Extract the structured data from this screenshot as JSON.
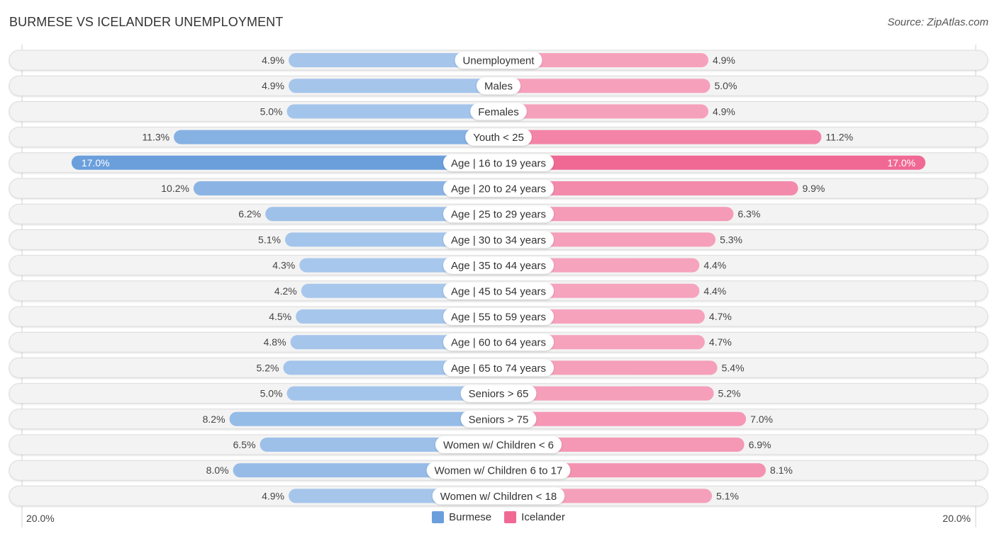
{
  "header": {
    "title": "BURMESE VS ICELANDER UNEMPLOYMENT",
    "source": "Source: ZipAtlas.com"
  },
  "colors": {
    "burmese": "#6a9fdc",
    "burmese_light": "#a9c8ec",
    "icelander": "#f06994",
    "icelander_light": "#f6a5bf"
  },
  "axis": {
    "left_label": "20.0%",
    "right_label": "20.0%"
  },
  "legend": {
    "items": [
      {
        "label": "Burmese",
        "color": "#6a9fdc"
      },
      {
        "label": "Icelander",
        "color": "#f06994"
      }
    ]
  },
  "chart_data": {
    "type": "bar",
    "orientation": "horizontal-diverging",
    "title": "BURMESE VS ICELANDER UNEMPLOYMENT",
    "xlabel": "",
    "ylabel": "",
    "xlim": [
      -20,
      20
    ],
    "legend_position": "bottom-center",
    "categories": [
      "Unemployment",
      "Males",
      "Females",
      "Youth < 25",
      "Age | 16 to 19 years",
      "Age | 20 to 24 years",
      "Age | 25 to 29 years",
      "Age | 30 to 34 years",
      "Age | 35 to 44 years",
      "Age | 45 to 54 years",
      "Age | 55 to 59 years",
      "Age | 60 to 64 years",
      "Age | 65 to 74 years",
      "Seniors > 65",
      "Seniors > 75",
      "Women w/ Children < 6",
      "Women w/ Children 6 to 17",
      "Women w/ Children < 18"
    ],
    "series": [
      {
        "name": "Burmese",
        "side": "left",
        "values": [
          4.9,
          4.9,
          5.0,
          11.3,
          17.0,
          10.2,
          6.2,
          5.1,
          4.3,
          4.2,
          4.5,
          4.8,
          5.2,
          5.0,
          8.2,
          6.5,
          8.0,
          4.9
        ],
        "labels": [
          "4.9%",
          "4.9%",
          "5.0%",
          "11.3%",
          "17.0%",
          "10.2%",
          "6.2%",
          "5.1%",
          "4.3%",
          "4.2%",
          "4.5%",
          "4.8%",
          "5.2%",
          "5.0%",
          "8.2%",
          "6.5%",
          "8.0%",
          "4.9%"
        ]
      },
      {
        "name": "Icelander",
        "side": "right",
        "values": [
          4.9,
          5.0,
          4.9,
          11.2,
          17.0,
          9.9,
          6.3,
          5.3,
          4.4,
          4.4,
          4.7,
          4.7,
          5.4,
          5.2,
          7.0,
          6.9,
          8.1,
          5.1
        ],
        "labels": [
          "4.9%",
          "5.0%",
          "4.9%",
          "11.2%",
          "17.0%",
          "9.9%",
          "6.3%",
          "5.3%",
          "4.4%",
          "4.4%",
          "4.7%",
          "4.7%",
          "5.4%",
          "5.2%",
          "7.0%",
          "6.9%",
          "8.1%",
          "5.1%"
        ]
      }
    ]
  }
}
